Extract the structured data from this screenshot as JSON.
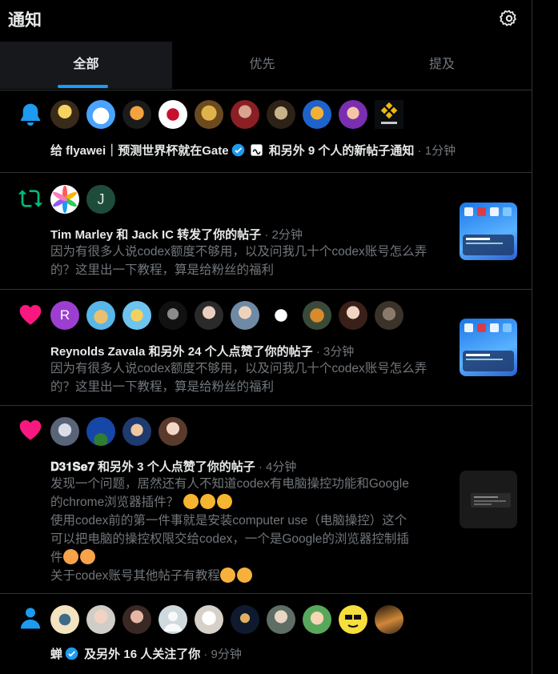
{
  "header": {
    "title": "通知"
  },
  "tabs": [
    {
      "label": "全部"
    },
    {
      "label": "优先"
    },
    {
      "label": "提及"
    }
  ],
  "notifications": [
    {
      "icon": "bell-icon",
      "line_prefix": "给 ",
      "actor": "flyawei｜预测世界杯就在Gate",
      "line_rest": " 和另外 9 个人的新帖子通知",
      "time": " · 1分钟"
    },
    {
      "icon": "repost-icon",
      "actor": "Tim Marley",
      "line_rest": " 和 ",
      "actor2": "Jack IC",
      "line_rest2": " 转发了你的帖子",
      "time": " · 2分钟",
      "avatar_letter": "J",
      "text": "因为有很多人说codex额度不够用，以及问我几十个codex账号怎么弄的？这里出一下教程，算是给粉丝的福利"
    },
    {
      "icon": "heart-icon",
      "actor": "Reynolds Zavala",
      "line_rest": " 和另外 24 个人点赞了你的帖子",
      "time": " · 3分钟",
      "avatar_letter": "R",
      "text": "因为有很多人说codex额度不够用，以及问我几十个codex账号怎么弄的？这里出一下教程，算是给粉丝的福利"
    },
    {
      "icon": "heart-icon",
      "actor": "𝐃𝟑𝟏𝐒𝐞𝟕",
      "line_rest": " 和另外 3 个人点赞了你的帖子",
      "time": " · 4分钟",
      "text_lines": [
        "发现一个问题，居然还有人不知道codex有电脑操控功能和Google",
        "的chrome浏览器插件？",
        "使用codex前的第一件事就是安装computer use（电脑操控）这个",
        "可以把电脑的操控权限交给codex，一个是Google的浏览器控制插",
        "件",
        "关于codex账号其他帖子有教程"
      ]
    },
    {
      "icon": "person-icon",
      "actor": "蝉",
      "line_rest": " 及另外 16 人关注了你",
      "time": " · 9分钟"
    }
  ],
  "colors": {
    "accent": "#1d9bf0",
    "like": "#f91880",
    "repost": "#00ba7c",
    "bg": "#000000",
    "muted": "#71767b"
  }
}
